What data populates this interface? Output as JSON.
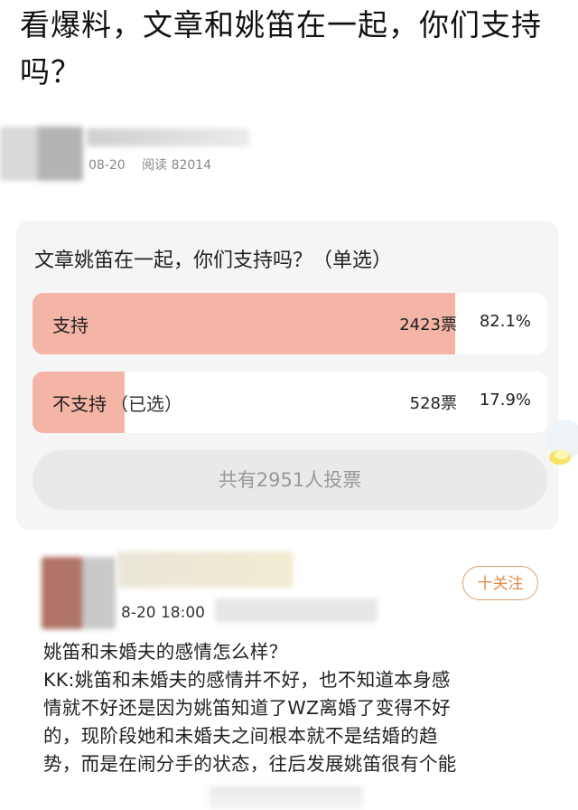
{
  "headline": "看爆料，文章和姚笛在一起，你们支持吗？",
  "post": {
    "date": "08-20",
    "reads": "阅读 82014"
  },
  "poll": {
    "title": "文章姚笛在一起，你们支持吗？（单选）",
    "options": [
      {
        "label": "支持",
        "selected_note": "",
        "votes": "2423票",
        "percent": "82.1%",
        "fraction": 0.821
      },
      {
        "label": "不支持",
        "selected_note": "（已选）",
        "votes": "528票",
        "percent": "17.9%",
        "fraction": 0.179
      }
    ],
    "total": "共有2951人投票",
    "fill_color": "#f4b4a6"
  },
  "comment": {
    "time": "8-20 18:00",
    "follow_label": "十关注",
    "lines": [
      "姚笛和未婚夫的感情怎么样？",
      "KK:姚笛和未婚夫的感情并不好，也不知道本身感",
      "情就不好还是因为姚笛知道了WZ离婚了变得不好",
      "的，现阶段她和未婚夫之间根本就不是结婚的趋",
      "势，而是在闹分手的状态，往后发展姚笛很有个能"
    ]
  }
}
